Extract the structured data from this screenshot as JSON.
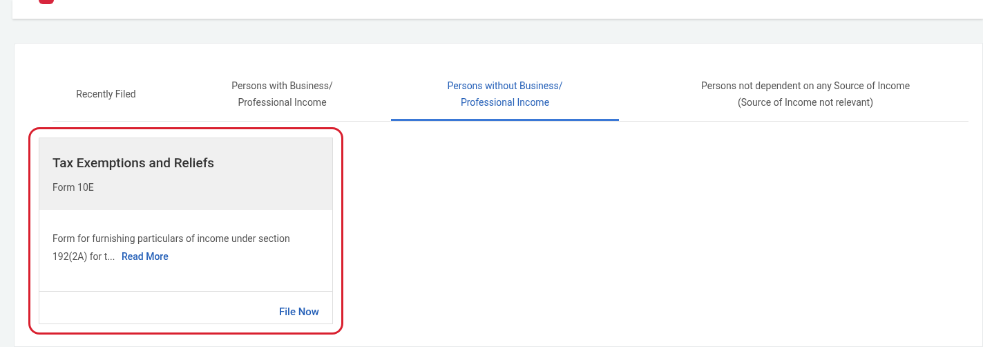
{
  "tabs": [
    {
      "lines": [
        "Recently Filed"
      ],
      "selected": false
    },
    {
      "lines": [
        "Persons with Business/",
        "Professional Income"
      ],
      "selected": false
    },
    {
      "lines": [
        "Persons without Business/",
        "Professional Income"
      ],
      "selected": true
    },
    {
      "lines": [
        "Persons not dependent on any Source of Income",
        "(Source of Income not relevant)"
      ],
      "selected": false
    }
  ],
  "cards": [
    {
      "title": "Tax Exemptions and Reliefs",
      "subtitle": "Form 10E",
      "description": "Form for furnishing particulars of income under section 192(2A) for t...",
      "read_more": "Read More",
      "action": "File Now",
      "highlighted": true
    }
  ]
}
